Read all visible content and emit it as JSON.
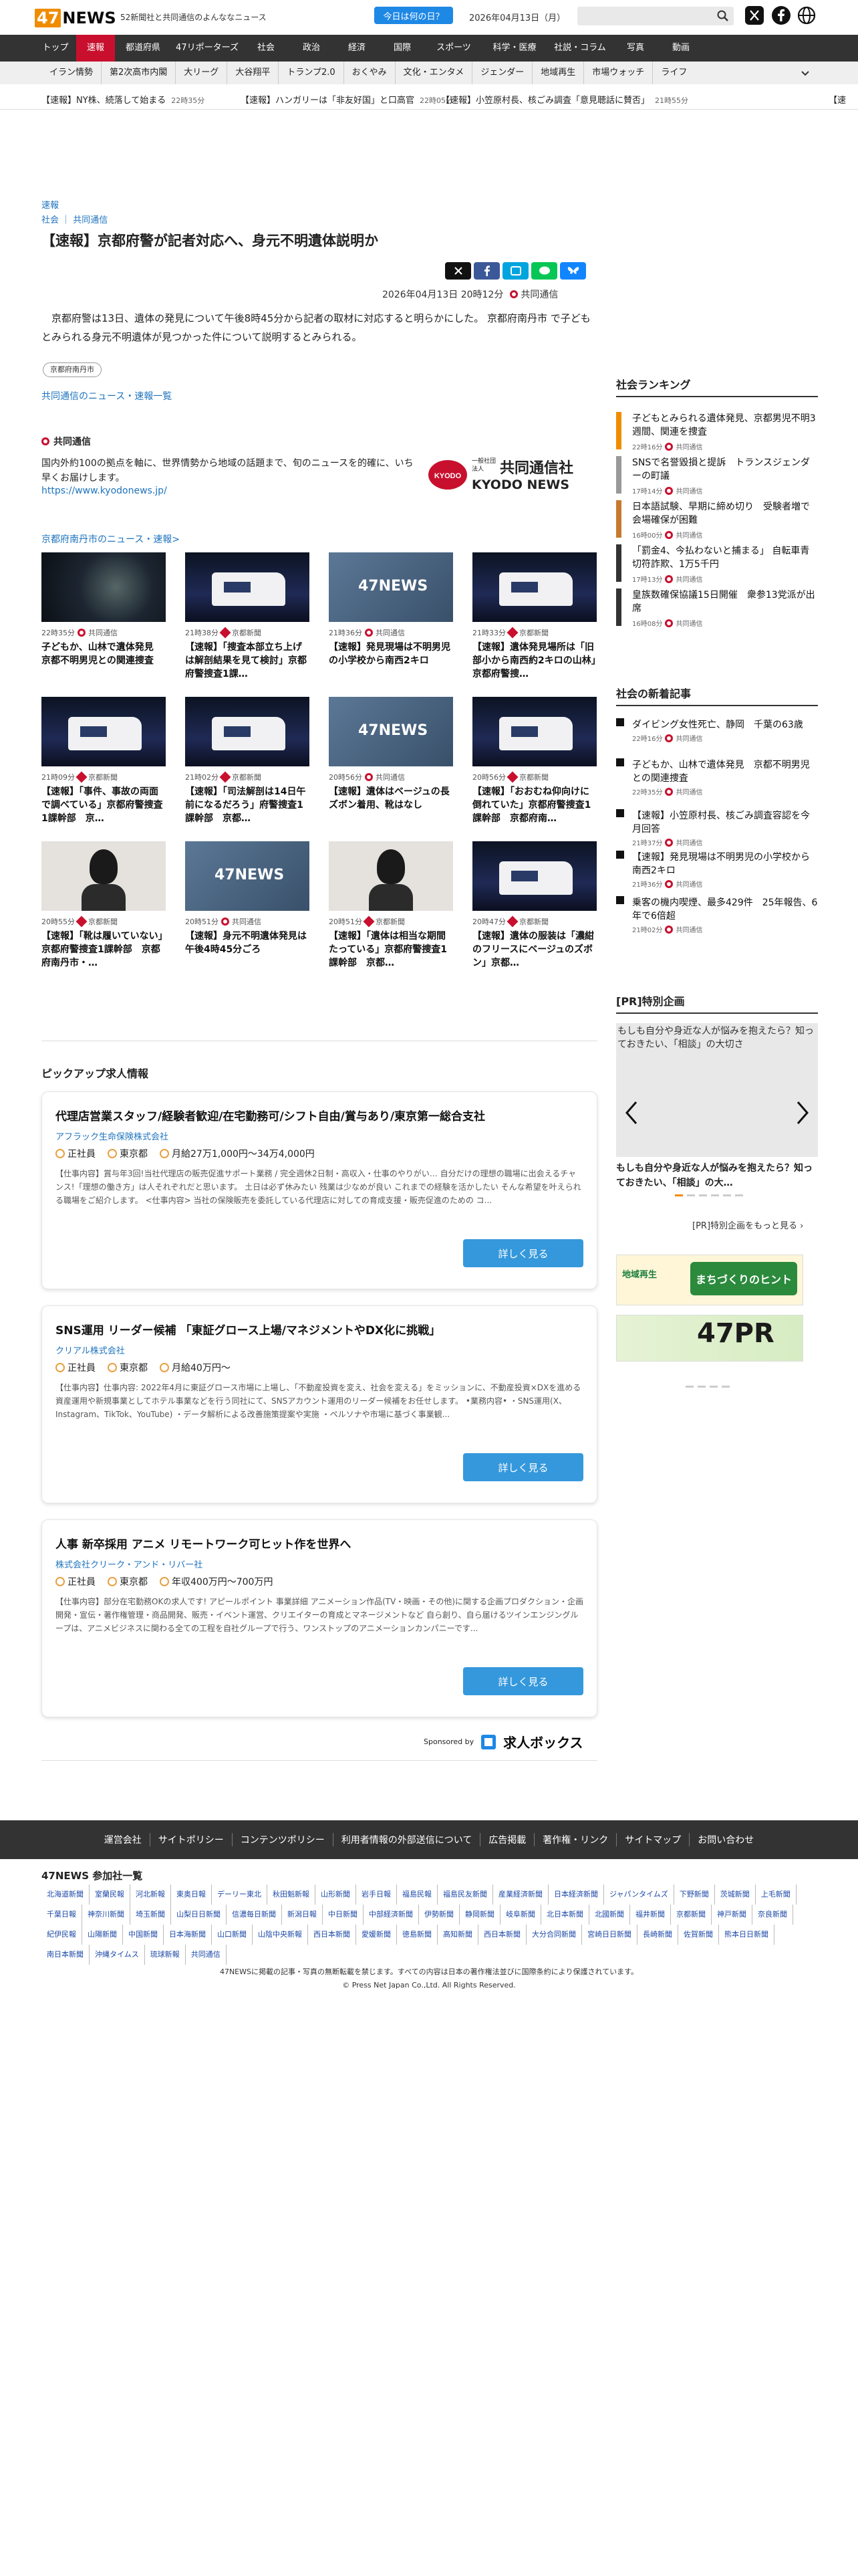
{
  "header": {
    "logo_47": "47",
    "logo_news": "NEWS",
    "tagline": "52新聞社と共同通信のよんななニュース",
    "today_button": "今日は何の日？",
    "date": "2026年04月13日（月）",
    "search_placeholder": ""
  },
  "nav": {
    "items": [
      "トップ",
      "速報",
      "都道府県",
      "47リポーターズ",
      "社会",
      "政治",
      "経済",
      "国際",
      "スポーツ",
      "科学・医療",
      "社説・コラム",
      "写真",
      "動画"
    ],
    "active": "速報"
  },
  "subnav": {
    "items": [
      "イラン情勢",
      "第2次高市内閣",
      "大リーグ",
      "大谷翔平",
      "トランプ2.0",
      "おくやみ",
      "文化・エンタメ",
      "ジェンダー",
      "地域再生",
      "市場ウォッチ",
      "ライフ"
    ]
  },
  "ticker": [
    {
      "text": "【速報】NY株、続落して始まる",
      "time": "22時35分"
    },
    {
      "text": "【速報】ハンガリーは「非友好国」と口高官",
      "time": "22時05分"
    },
    {
      "text": "【速報】小笠原村長、核ごみ調査「意見聴話に賛否」",
      "time": "21時55分"
    },
    {
      "text": "【速",
      "time": ""
    }
  ],
  "article": {
    "category": "速報",
    "breadcrumb_1": "社会",
    "breadcrumb_2": "共同通信",
    "title": "【速報】京都府警が記者対応へ、身元不明遺体説明か",
    "datetime": "2026年04月13日 20時12分",
    "source": "共同通信",
    "body": "京都府警は13日、遺体の発見について午後8時45分から記者の取材に対応すると明らかにした。 京都府南丹市 で子どもとみられる身元不明遺体が見つかった件について説明するとみられる。",
    "tag": "京都府南丹市",
    "more_link": "共同通信のニュース・速報一覧"
  },
  "share": {
    "x": "X",
    "facebook": "f",
    "hatena": "B!",
    "line": "LINE",
    "bluesky": "bsky"
  },
  "kyodo": {
    "name": "共同通信",
    "desc": "国内外約100の拠点を軸に、世界情勢から地域の話題まで、旬のニュースを的確に、いち早くお届けします。",
    "url": "https://www.kyodonews.jp/",
    "logo_small": "一般社団法人",
    "logo_main": "共同通信社",
    "logo_en": "KYODO NEWS"
  },
  "local_news_link": "京都府南丹市のニュース・速報>",
  "grid": [
    {
      "time": "22時35分",
      "src": "共同通信",
      "title": "子どもか、山林で遺体発見　京都不明男児との関連捜査",
      "img": "night",
      "srctype": "kyodo"
    },
    {
      "time": "21時38分",
      "src": "京都新聞",
      "title": "【速報】「捜査本部立ち上げは解剖結果を見て検討」京都府警捜査1課…",
      "img": "van",
      "srctype": "kyoto"
    },
    {
      "time": "21時36分",
      "src": "共同通信",
      "title": "【速報】発見現場は不明男児の小学校から南西2キロ",
      "img": "sky",
      "srctype": "kyodo"
    },
    {
      "time": "21時33分",
      "src": "京都新聞",
      "title": "【速報】遺体発見場所は「旧部小から南西約2キロの山林」京都府警捜…",
      "img": "van",
      "srctype": "kyoto"
    },
    {
      "time": "21時09分",
      "src": "京都新聞",
      "title": "【速報】「事件、事故の両面で調べている」京都府警捜査1課幹部　京…",
      "img": "van",
      "srctype": "kyoto"
    },
    {
      "time": "21時02分",
      "src": "京都新聞",
      "title": "【速報】「司法解剖は14日午前になるだろう」府警捜査1課幹部　京都…",
      "img": "van",
      "srctype": "kyoto"
    },
    {
      "time": "20時56分",
      "src": "共同通信",
      "title": "【速報】遺体はベージュの長ズボン着用、靴はなし",
      "img": "sky",
      "srctype": "kyodo"
    },
    {
      "time": "20時56分",
      "src": "京都新聞",
      "title": "【速報】「おおむね仰向けに倒れていた」京都府警捜査1課幹部　京都府南…",
      "img": "van",
      "srctype": "kyoto"
    },
    {
      "time": "20時55分",
      "src": "京都新聞",
      "title": "【速報】「靴は履いていない」京都府警捜査1課幹部　京都府南丹市・…",
      "img": "person",
      "srctype": "kyoto"
    },
    {
      "time": "20時51分",
      "src": "共同通信",
      "title": "【速報】身元不明遺体発見は午後4時45分ごろ",
      "img": "sky",
      "srctype": "kyodo"
    },
    {
      "time": "20時51分",
      "src": "京都新聞",
      "title": "【速報】「遺体は相当な期間たっている」京都府警捜査1課幹部　京都…",
      "img": "person",
      "srctype": "kyoto"
    },
    {
      "time": "20時47分",
      "src": "京都新聞",
      "title": "【速報】遺体の服装は「濃紺のフリースにベージュのズボン」京都…",
      "img": "van",
      "srctype": "kyoto"
    }
  ],
  "jobs": {
    "heading": "ピックアップ求人情報",
    "items": [
      {
        "title": "代理店営業スタッフ/経験者歓迎/在宅勤務可/シフト自由/賞与あり/東京第一総合支社",
        "company": "アフラック生命保険株式会社",
        "type": "正社員",
        "place": "東京都",
        "pay": "月給27万1,000円〜34万4,000円",
        "desc": "【仕事内容】賞与年3回!当社代理店の販売促進サポート業務 / 完全週休2日制・高収入・仕事のやりがい… 自分だけの理想の職場に出会えるチャンス!「理想の働き方」は人それぞれだと思います。 土日は必ず休みたい 残業は少なめが良い これまでの経験を活かしたい そんな希望を叶えられる職場をご紹介します。 <仕事内容> 当社の保険販売を委託している代理店に対しての育成支援・販売促進のための コ...",
        "button": "詳しく見る"
      },
      {
        "title": "SNS運用 リーダー候補 「東証グロース上場/マネジメントやDX化に挑戦」",
        "company": "クリアル株式会社",
        "type": "正社員",
        "place": "東京都",
        "pay": "月給40万円〜",
        "desc": "【仕事内容】仕事内容: 2022年4月に東証グロース市場に上場し、「不動産投資を変え、社会を変える」をミッションに、不動産投資×DXを進める資産運用や新規事業としてホテル事業などを行う同社にて、SNSアカウント運用のリーダー候補をお任せします。 •業務内容• ・SNS運用(X、Instagram、TikTok、YouTube) ・データ解析による改善施策提案や実施 ・ペルソナや市場に基づく事業観...",
        "button": "詳しく見る"
      },
      {
        "title": "人事 新卒採用 アニメ リモートワーク可ヒット作を世界へ",
        "company": "株式会社クリーク・アンド・リバー社",
        "type": "正社員",
        "place": "東京都",
        "pay": "年収400万円〜700万円",
        "desc": "【仕事内容】部分在宅勤務OKの求人です! アピールポイント 事業詳細 アニメーション作品(TV・映画・その他)に関する企画プロダクション・企画開発・宣伝・著作権管理・商品開発、販売・イベント運営、クリエイターの育成とマネージメントなど 自ら創り、自ら届けるツインエンジングループは、アニメビジネスに関わる全ての工程を自社グループで行う、ワンストップのアニメーションカンパニーです...",
        "button": "詳しく見る"
      }
    ],
    "sponsor_label": "Sponsored by",
    "sponsor_name": "求人ボックス"
  },
  "sidebar": {
    "ranking_title": "社会ランキング",
    "ranking": [
      {
        "title": "子どもとみられる遺体発見、京都男児不明3週間、関連を捜査",
        "time": "22時16分",
        "src": "共同通信",
        "color": "#f08c00"
      },
      {
        "title": "SNSで名誉毀損と提訴　トランスジェンダーの町議",
        "time": "17時14分",
        "src": "共同通信",
        "color": "#999999"
      },
      {
        "title": "日本語試験、早期に締め切り　受験者増で会場確保が困難",
        "time": "16時00分",
        "src": "共同通信",
        "color": "#c77a2e"
      },
      {
        "title": "「罰金4、今払わないと捕まる」 自転車青切符詐欺、1万5千円",
        "time": "17時13分",
        "src": "共同通信",
        "color": "#333333"
      },
      {
        "title": "皇族数確保協議15日開催　衆参13党派が出席",
        "time": "16時08分",
        "src": "共同通信",
        "color": "#333333"
      }
    ],
    "new_title": "社会の新着記事",
    "new": [
      {
        "title": "ダイビング女性死亡、静岡　千葉の63歳",
        "time": "22時16分",
        "src": "共同通信"
      },
      {
        "title": "子どもか、山林で遺体発見　京都不明男児との関連捜査",
        "time": "22時35分",
        "src": "共同通信"
      },
      {
        "title": "【速報】小笠原村長、核ごみ調査容認を今月回答",
        "time": "21時37分",
        "src": "共同通信"
      },
      {
        "title": "【速報】発見現場は不明男児の小学校から南西2キロ",
        "time": "21時36分",
        "src": "共同通信"
      },
      {
        "title": "乗客の機内喫煙、最多429件　25年報告、6年で6倍超",
        "time": "21時02分",
        "src": "共同通信"
      }
    ],
    "pr_title": "[PR]特別企画",
    "pr_img_alt": "もしも自分や身近な人が悩みを抱えたら？知っておきたい、「相談」の大切さ",
    "pr_caption": "もしも自分や身近な人が悩みを抱えたら？知っておきたい、「相談」の大…",
    "pr_more": "[PR]特別企画をもっと見る ›",
    "banner1_small": "地域再生",
    "banner1_main": "まちづくりのヒント",
    "banner2_main": "47PR"
  },
  "footer": {
    "links": [
      "運営会社",
      "サイトポリシー",
      "コンテンツポリシー",
      "利用者情報の外部送信について",
      "広告掲載",
      "著作権・リンク",
      "サイトマップ",
      "お問い合わせ"
    ],
    "particip_title": "47NEWS 参加社一覧",
    "papers": [
      "北海道新聞",
      "室蘭民報",
      "河北新報",
      "東奥日報",
      "デーリー東北",
      "秋田魁新報",
      "山形新聞",
      "岩手日報",
      "福島民報",
      "福島民友新聞",
      "産業経済新聞",
      "日本経済新聞",
      "ジャパンタイムズ",
      "下野新聞",
      "茨城新聞",
      "上毛新聞",
      "千葉日報",
      "神奈川新聞",
      "埼玉新聞",
      "山梨日日新聞",
      "信濃毎日新聞",
      "新潟日報",
      "中日新聞",
      "中部経済新聞",
      "伊勢新聞",
      "静岡新聞",
      "岐阜新聞",
      "北日本新聞",
      "北國新聞",
      "福井新聞",
      "京都新聞",
      "神戸新聞",
      "奈良新聞",
      "紀伊民報",
      "山陽新聞",
      "中国新聞",
      "日本海新聞",
      "山口新聞",
      "山陰中央新報",
      "西日本新聞",
      "愛媛新聞",
      "徳島新聞",
      "高知新聞",
      "西日本新聞",
      "大分合同新聞",
      "宮崎日日新聞",
      "長崎新聞",
      "佐賀新聞",
      "熊本日日新聞",
      "南日本新聞",
      "沖縄タイムス",
      "琉球新報",
      "共同通信"
    ],
    "copy1": "47NEWSに掲載の記事・写真の無断転載を禁じます。すべての内容は日本の著作権法並びに国際条約により保護されています。",
    "copy2": "© Press Net Japan Co.,Ltd. All Rights Reserved."
  },
  "colors": {
    "accent": "#c8102e",
    "brand": "#f08c00",
    "link": "#1e73be",
    "nav_bg": "#333333",
    "button": "#3598dc"
  }
}
